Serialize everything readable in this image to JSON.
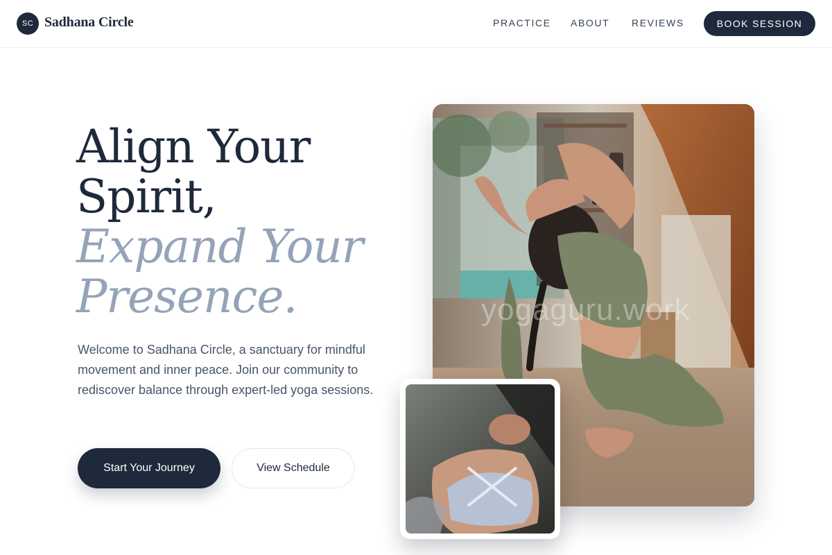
{
  "header": {
    "logo_initials": "SC",
    "brand": "Sadhana Circle",
    "nav": [
      "PRACTICE",
      "ABOUT",
      "REVIEWS"
    ],
    "cta": "BOOK SESSION"
  },
  "hero": {
    "headline_line1": "Align Your",
    "headline_line2": "Spirit,",
    "headline_accent1": "Expand Your",
    "headline_accent2": "Presence.",
    "lede": "Welcome to Sadhana Circle, a sanctuary for mindful movement and inner peace. Join our community to rediscover balance through expert-led yoga sessions.",
    "primary_button": "Start Your Journey",
    "secondary_button": "View Schedule"
  },
  "media": {
    "main_photo_watermark": "yogaguru.work",
    "main_photo_icon": "yoga-pose-photo",
    "secondary_photo_icon": "meditation-photo"
  },
  "colors": {
    "primary": "#1e293b",
    "accent_text": "#94a3b8",
    "body_text": "#475569"
  }
}
